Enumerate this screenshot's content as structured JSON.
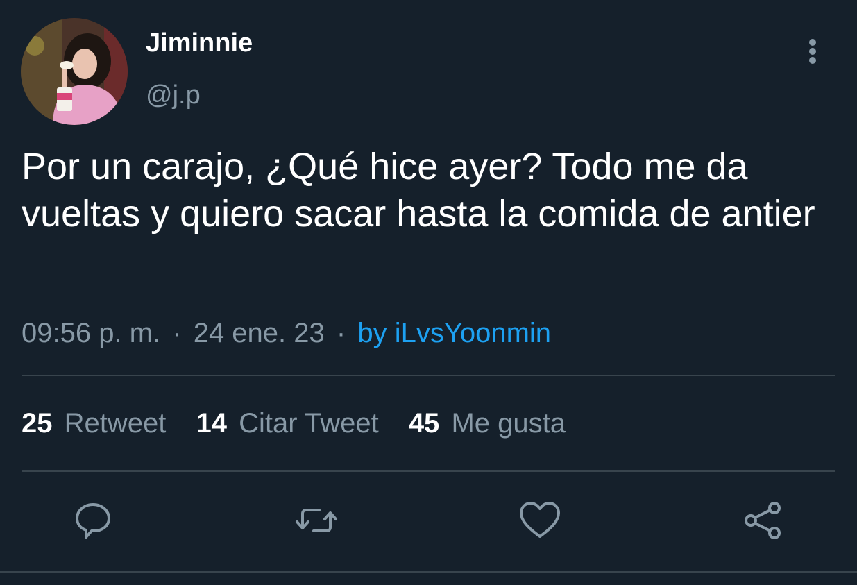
{
  "user": {
    "display_name": "Jiminnie",
    "handle": "@j.p",
    "avatar": "profile-photo"
  },
  "tweet": {
    "text": "Por un carajo, ¿Qué hice ayer? Todo me da vueltas y quiero sacar hasta la comida de antier",
    "time": "09:56 p. m.",
    "separator": "·",
    "date": "24 ene. 23",
    "source": "by iLvsYoonmin"
  },
  "stats": {
    "retweets_count": "25",
    "retweets_label": "Retweet",
    "quotes_count": "14",
    "quotes_label": "Citar Tweet",
    "likes_count": "45",
    "likes_label": "Me gusta"
  },
  "actions": {
    "reply_icon": "reply-icon",
    "retweet_icon": "retweet-icon",
    "like_icon": "heart-icon",
    "share_icon": "share-icon",
    "more_icon": "more-vertical-icon"
  },
  "colors": {
    "background": "#15202b",
    "text_primary": "#ffffff",
    "text_secondary": "#8899a6",
    "link": "#1da1f2",
    "divider": "#38444d"
  }
}
